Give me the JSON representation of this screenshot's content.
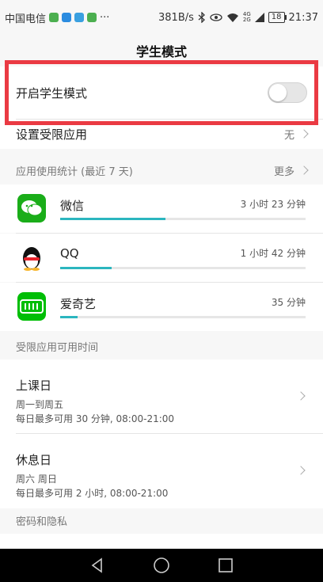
{
  "status_bar": {
    "carrier": "中国电信",
    "dots": "···",
    "speed": "381B/s",
    "net_top": "4G",
    "net_bottom": "2G",
    "battery": "18",
    "time": "21:37"
  },
  "header": {
    "title": "学生模式"
  },
  "student_mode": {
    "label": "开启学生模式",
    "enabled": false
  },
  "restricted_apps": {
    "label": "设置受限应用",
    "value": "无"
  },
  "usage_section": {
    "title": "应用使用统计 (最近 7 天)",
    "more": "更多"
  },
  "apps": [
    {
      "name": "微信",
      "time": "3 小时 23 分钟",
      "progress": 0.43,
      "icon": "wechat-icon",
      "color": "#1aad19"
    },
    {
      "name": "QQ",
      "time": "1 小时 42 分钟",
      "progress": 0.21,
      "icon": "qq-icon",
      "color": "#000000"
    },
    {
      "name": "爱奇艺",
      "time": "35 分钟",
      "progress": 0.07,
      "icon": "iqiyi-icon",
      "color": "#00be06"
    }
  ],
  "available_time_section": {
    "title": "受限应用可用时间"
  },
  "schedules": [
    {
      "title": "上课日",
      "days": "周一到周五",
      "limit": "每日最多可用 30 分钟, 08:00-21:00"
    },
    {
      "title": "休息日",
      "days": "周六 周日",
      "limit": "每日最多可用 2 小时, 08:00-21:00"
    }
  ],
  "privacy_section": {
    "title": "密码和隐私"
  },
  "colors": {
    "accent": "#2bb6bf",
    "highlight": "#ea3a43",
    "background": "#f7f7f7"
  }
}
